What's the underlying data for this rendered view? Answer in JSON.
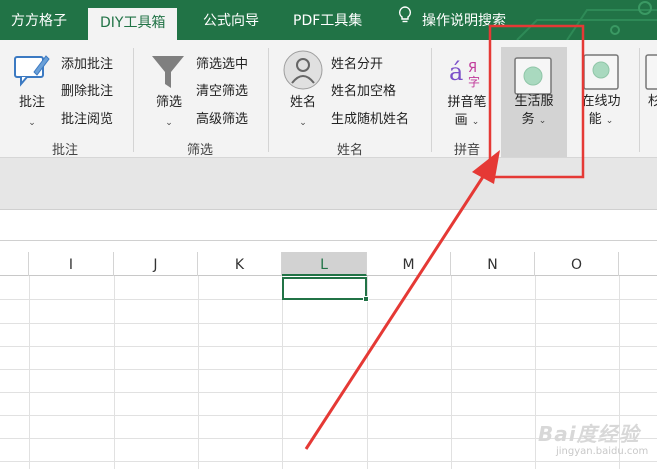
{
  "tabs": {
    "t1": "方方格子",
    "t2": "DIY工具箱",
    "t3": "公式向导",
    "t4": "PDF工具集",
    "t5": "操作说明搜索"
  },
  "ribbon": {
    "pizhu": {
      "big": "批注",
      "add": "添加批注",
      "del": "删除批注",
      "read": "批注阅览",
      "group": "批注"
    },
    "shaixuan": {
      "big": "筛选",
      "sel": "筛选选中",
      "clear": "清空筛选",
      "adv": "高级筛选",
      "group": "筛选"
    },
    "xingming": {
      "big": "姓名",
      "split": "姓名分开",
      "space": "姓名加空格",
      "gen": "生成随机姓名",
      "group": "姓名"
    },
    "pinyin": {
      "big1": "拼音笔",
      "big2": "画",
      "group": "拼音"
    },
    "life": {
      "l1": "生活服",
      "l2": "务"
    },
    "online": {
      "l1": "在线功",
      "l2": "能"
    },
    "partial": "杉",
    "chevron": "⌄"
  },
  "columns": [
    "I",
    "J",
    "K",
    "L",
    "M",
    "N",
    "O"
  ],
  "selected_column": "L",
  "accent_color": "#217346",
  "highlight_color": "#e53935",
  "watermark": {
    "brand": "Bai度经验",
    "url": "jingyan.baidu.com"
  }
}
